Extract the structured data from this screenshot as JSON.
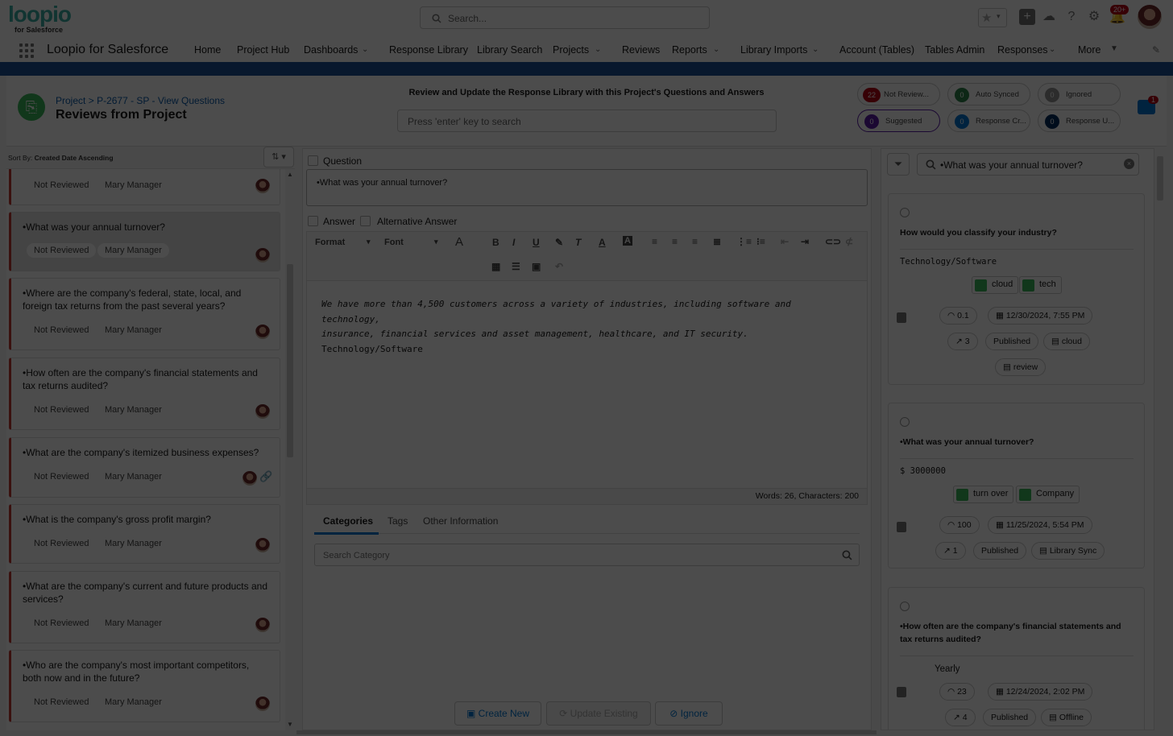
{
  "colors": {
    "brand": "#3bb0a6",
    "nav_accent": "#1b5297",
    "link": "#0b5cab",
    "primary": "#0176d3",
    "status_red": "#c23934",
    "overlay": "rgba(0,0,0,0.70)"
  },
  "header": {
    "logo_text": "loopio",
    "logo_sub": "for Salesforce",
    "search_placeholder": "Search...",
    "notif_count": "20+",
    "icons": [
      "star-icon",
      "chevron-down-icon",
      "add-icon",
      "cloud-icon",
      "help-icon",
      "gear-icon",
      "bell-icon"
    ]
  },
  "nav": {
    "app_name": "Loopio for Salesforce",
    "items": [
      {
        "label": "Home",
        "dropdown": false
      },
      {
        "label": "Project Hub",
        "dropdown": false
      },
      {
        "label": "Dashboards",
        "dropdown": true
      },
      {
        "label": "Response Library",
        "dropdown": false
      },
      {
        "label": "Library Search",
        "dropdown": false
      },
      {
        "label": "Projects",
        "dropdown": true
      },
      {
        "label": "Reviews",
        "dropdown": false
      },
      {
        "label": "Reports",
        "dropdown": true
      },
      {
        "label": "Library Imports",
        "dropdown": true
      },
      {
        "label": "Account (Tables)",
        "dropdown": false
      },
      {
        "label": "Tables Admin",
        "dropdown": false
      },
      {
        "label": "Responses",
        "dropdown": true
      },
      {
        "label": "More",
        "dropdown": true
      }
    ]
  },
  "project": {
    "breadcrumb_root": "Project",
    "breadcrumb_sep": ">",
    "breadcrumb_project": "P-2677 - SP - View Questions",
    "title": "Reviews from Project",
    "center_title": "Review and Update the Response Library with this Project's Questions and Answers",
    "search_placeholder": "Press 'enter' key to search",
    "pills": [
      {
        "count": "22",
        "label": "Not Review...",
        "color": "#ba0517"
      },
      {
        "count": "0",
        "label": "Auto Synced",
        "color": "#2e844a"
      },
      {
        "count": "0",
        "label": "Ignored",
        "color": "#939393"
      },
      {
        "count": "0",
        "label": "Suggested",
        "color": "#5a1ba9"
      },
      {
        "count": "0",
        "label": "Response Cr...",
        "color": "#0176d3"
      },
      {
        "count": "0",
        "label": "Response U...",
        "color": "#032d60"
      }
    ],
    "notif_count": "1"
  },
  "left": {
    "sort_label": "Sort By:",
    "sort_value": "Created Date Ascending",
    "questions": [
      {
        "text": "",
        "status": "Not Reviewed",
        "owner": "Mary Manager",
        "selected": false,
        "attachment": false
      },
      {
        "text": "•What was your annual turnover?",
        "status": "Not Reviewed",
        "owner": "Mary Manager",
        "selected": true,
        "attachment": false
      },
      {
        "text": "•Where are the company's federal, state, local, and foreign tax returns from the past several years?",
        "status": "Not Reviewed",
        "owner": "Mary Manager",
        "selected": false,
        "attachment": false
      },
      {
        "text": "•How often are the company's financial statements and tax returns audited?",
        "status": "Not Reviewed",
        "owner": "Mary Manager",
        "selected": false,
        "attachment": false
      },
      {
        "text": "•What are the company's itemized business expenses?",
        "status": "Not Reviewed",
        "owner": "Mary Manager",
        "selected": false,
        "attachment": true
      },
      {
        "text": "•What is the company's gross profit margin?",
        "status": "Not Reviewed",
        "owner": "Mary Manager",
        "selected": false,
        "attachment": false
      },
      {
        "text": "•What are the company's current and future products and services?",
        "status": "Not Reviewed",
        "owner": "Mary Manager",
        "selected": false,
        "attachment": false
      },
      {
        "text": "•Who are the company's most important competitors, both now and in the future?",
        "status": "Not Reviewed",
        "owner": "Mary Manager",
        "selected": false,
        "attachment": false
      }
    ]
  },
  "middle": {
    "question_label": "Question",
    "question_value": "•What was your annual turnover?",
    "answer_label": "Answer",
    "alt_answer_label": "Alternative Answer",
    "format_label": "Format",
    "font_label": "Font",
    "answer_line1": "We have more than 4,500 customers across a variety of industries, including software and technology,",
    "answer_line2": "insurance, financial services and asset management, healthcare, and IT security.",
    "answer_line3": "Technology/Software",
    "word_count": "Words: 26, Characters: 200",
    "tabs": [
      "Categories",
      "Tags",
      "Other Information"
    ],
    "category_placeholder": "Search Category",
    "buttons": {
      "create": "Create New",
      "update": "Update Existing",
      "ignore": "Ignore"
    }
  },
  "right": {
    "search_value": "•What was your annual turnover?",
    "results": [
      {
        "question": "How would you classify your industry?",
        "answer": "Technology/Software",
        "tags": [
          "cloud",
          "tech"
        ],
        "score": "0.1",
        "date": "12/30/2024, 7:55 PM",
        "uses": "3",
        "status": "Published",
        "chips": [
          "cloud",
          "review"
        ]
      },
      {
        "question": "•What was your annual turnover?",
        "answer": "$ 3000000",
        "tags": [
          "turn over",
          "Company"
        ],
        "score": "100",
        "date": "11/25/2024, 5:54 PM",
        "uses": "1",
        "status": "Published",
        "chips": [
          "Library Sync"
        ]
      },
      {
        "question": "•How often are the company's financial statements and tax returns audited?",
        "answer": "Yearly",
        "tags": [],
        "score": "23",
        "date": "12/24/2024, 2:02 PM",
        "uses": "4",
        "status": "Published",
        "chips": [
          "Offline"
        ]
      }
    ]
  }
}
